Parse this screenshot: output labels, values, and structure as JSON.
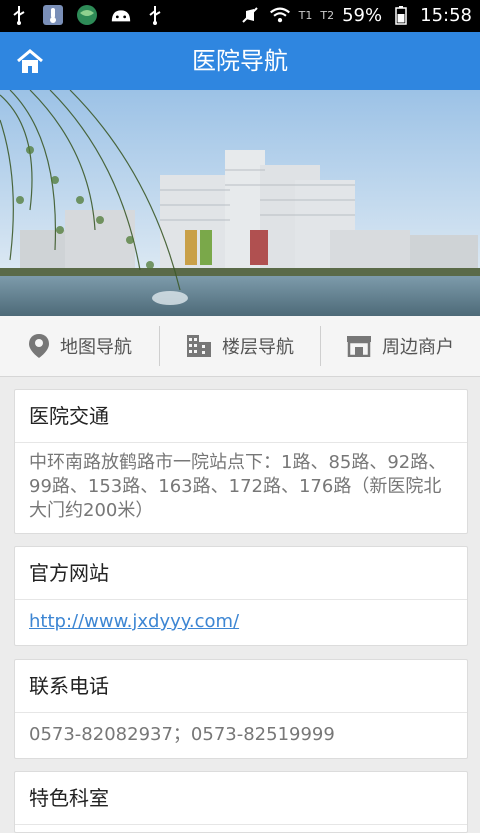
{
  "status_bar": {
    "battery": "59%",
    "time": "15:58",
    "sim1": "T1",
    "sim2": "T2"
  },
  "header": {
    "title": "医院导航"
  },
  "nav": {
    "items": [
      {
        "label": "地图导航",
        "icon": "map-pin-icon"
      },
      {
        "label": "楼层导航",
        "icon": "building-icon"
      },
      {
        "label": "周边商户",
        "icon": "store-icon"
      }
    ]
  },
  "cards": [
    {
      "title": "医院交通",
      "content": "中环南路放鹤路市一院站点下：1路、85路、92路、99路、153路、163路、172路、176路（新医院北大门约200米）"
    },
    {
      "title": "官方网站",
      "content": "http://www.jxdyyy.com/"
    },
    {
      "title": "联系电话",
      "content": "0573-82082937；0573-82519999"
    },
    {
      "title": "特色科室",
      "content": ""
    }
  ],
  "colors": {
    "header_bg": "#2f86e0",
    "link": "#3d86d3",
    "background": "#ececec"
  }
}
